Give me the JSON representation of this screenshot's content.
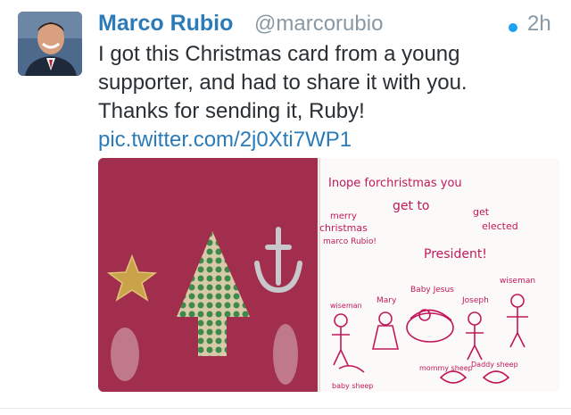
{
  "tweet": {
    "display_name": "Marco Rubio",
    "handle": "@marcorubio",
    "timestamp": "2h",
    "text_lines": [
      "I got this Christmas card from a young",
      "supporter, and had to share it with you.",
      "Thanks for sending it, Ruby!"
    ],
    "link": "pic.twitter.com/2j0Xti7WP1"
  },
  "colors": {
    "name_blue": "#2b7bb9",
    "unread_dot": "#1da1f2",
    "meta_gray": "#8899a6",
    "text": "#292f33",
    "card_red": "#9b2c4a"
  },
  "card": {
    "handwriting": {
      "line1": "Inope forchristmas you",
      "line2": "get to",
      "line3": "get",
      "line4": "elected",
      "line5": "merry",
      "line6": "christmas",
      "line7": "marco Rubio!",
      "line8": "President!",
      "wiseman_left": "wiseman",
      "mary": "Mary",
      "baby_jesus": "Baby Jesus",
      "joseph": "Joseph",
      "wiseman_right": "wiseman",
      "mommy_sheep": "mommy sheep",
      "daddy_sheep": "Daddy sheep",
      "baby_sheep": "baby sheep"
    }
  }
}
